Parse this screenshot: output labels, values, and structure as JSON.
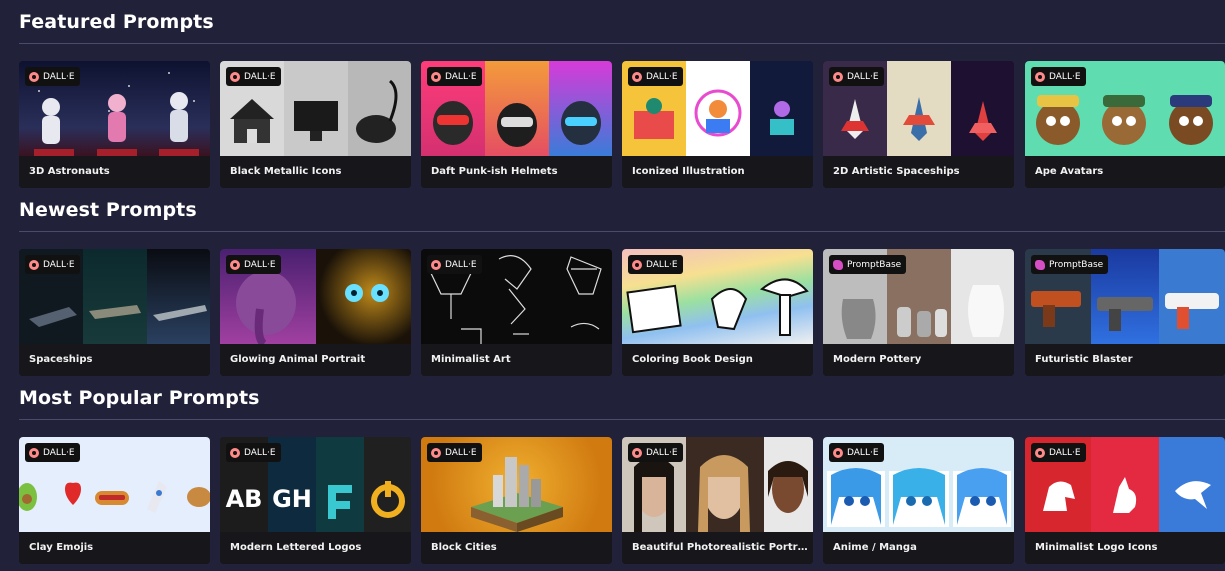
{
  "sections": [
    {
      "title": "Featured Prompts",
      "cards": [
        {
          "title": "3D Astronauts",
          "badge": "DALL·E",
          "badge_icon": "dalle-icon"
        },
        {
          "title": "Black Metallic Icons",
          "badge": "DALL·E",
          "badge_icon": "dalle-icon"
        },
        {
          "title": "Daft Punk-ish Helmets",
          "badge": "DALL·E",
          "badge_icon": "dalle-icon"
        },
        {
          "title": "Iconized Illustration",
          "badge": "DALL·E",
          "badge_icon": "dalle-icon"
        },
        {
          "title": "2D Artistic Spaceships",
          "badge": "DALL·E",
          "badge_icon": "dalle-icon"
        },
        {
          "title": "Ape Avatars",
          "badge": "DALL·E",
          "badge_icon": "dalle-icon"
        }
      ]
    },
    {
      "title": "Newest Prompts",
      "cards": [
        {
          "title": "Spaceships",
          "badge": "DALL·E",
          "badge_icon": "dalle-icon"
        },
        {
          "title": "Glowing Animal Portrait",
          "badge": "DALL·E",
          "badge_icon": "dalle-icon"
        },
        {
          "title": "Minimalist Art",
          "badge": "DALL·E",
          "badge_icon": "dalle-icon"
        },
        {
          "title": "Coloring Book Design",
          "badge": "DALL·E",
          "badge_icon": "dalle-icon"
        },
        {
          "title": "Modern Pottery",
          "badge": "PromptBase",
          "badge_icon": "promptbase-icon"
        },
        {
          "title": "Futuristic Blaster",
          "badge": "PromptBase",
          "badge_icon": "promptbase-icon"
        }
      ]
    },
    {
      "title": "Most Popular Prompts",
      "cards": [
        {
          "title": "Clay Emojis",
          "badge": "DALL·E",
          "badge_icon": "dalle-icon"
        },
        {
          "title": "Modern Lettered Logos",
          "badge": "DALL·E",
          "badge_icon": "dalle-icon",
          "logo_text": [
            "AB",
            "GH"
          ]
        },
        {
          "title": "Block Cities",
          "badge": "DALL·E",
          "badge_icon": "dalle-icon"
        },
        {
          "title": "Beautiful Photorealistic Portraits of ...",
          "badge": "DALL·E",
          "badge_icon": "dalle-icon"
        },
        {
          "title": "Anime / Manga",
          "badge": "DALL·E",
          "badge_icon": "dalle-icon"
        },
        {
          "title": "Minimalist Logo Icons",
          "badge": "DALL·E",
          "badge_icon": "dalle-icon"
        }
      ]
    }
  ],
  "colors": {
    "page_background": "#21213a",
    "caption_background": "#16161b",
    "divider": "#4a4a6a",
    "dalle_badge_icon": "#ff8a8a",
    "promptbase_badge_icon": "#d64ec4"
  }
}
